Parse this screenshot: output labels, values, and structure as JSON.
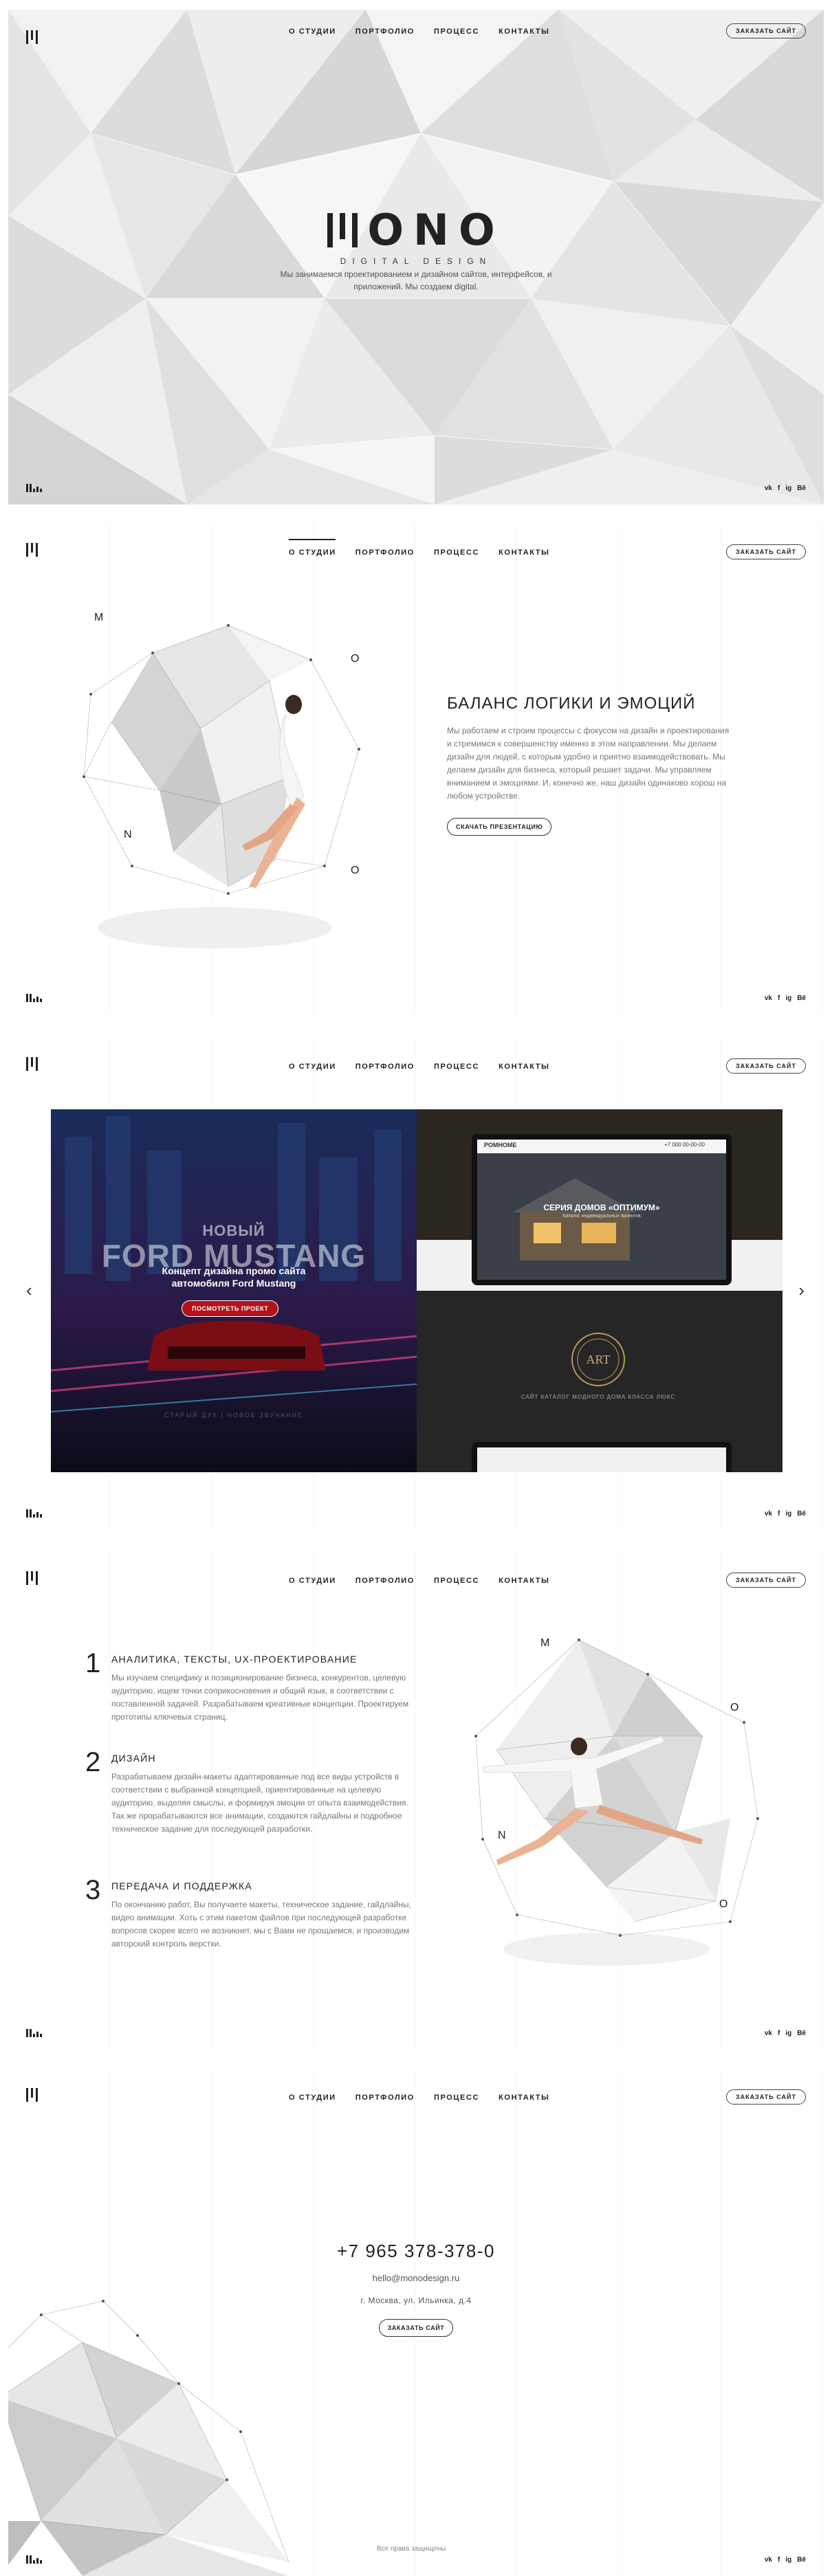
{
  "nav": [
    "О СТУДИИ",
    "ПОРТФОЛИО",
    "ПРОЦЕСС",
    "КОНТАКТЫ"
  ],
  "order_button": "ЗАКАЗАТЬ САЙТ",
  "socials": [
    "vk",
    "f",
    "ig",
    "Bē"
  ],
  "hero": {
    "logo_word": "ONO",
    "logo_sub": "DIGITAL DESIGN",
    "text": "Мы занимаемся проектированием и дизайном сайтов, интерфейсов, и приложений. Мы создаем digital."
  },
  "balance": {
    "title": "БАЛАНС ЛОГИКИ И ЭМОЦИЙ",
    "text": "Мы работаем и строим процессы с фокусом на дизайн и проектирования и стремимся к совершенству именно в этом направлении. Мы делаем дизайн для людей, с которым удобно и приятно взаимодействовать. Мы делаем дизайн для бизнеса, который решает задачи. Мы управляем вниманием и эмоциями. И, конечно же, наш дизайн одинаково хорош на любом устройстве.",
    "button": "СКАЧАТЬ ПРЕЗЕНТАЦИЮ",
    "letters": [
      "M",
      "O",
      "N",
      "O"
    ]
  },
  "portfolio": {
    "mustang_new": "НОВЫЙ",
    "mustang_title": "FORD MUSTANG",
    "mustang_caption": "Концепт дизайна промо сайта автомобиля Ford Mustang",
    "mustang_button": "ПОСМОТРЕТЬ ПРОЕКТ",
    "mustang_footer": "СТАРЫЙ ДУХ | НОВОЕ ЗВУЧАНИЕ",
    "house_brand": "РОМНОМЕ",
    "house_phone": "+7 000 00-00-00",
    "house_title": "СЕРИЯ ДОМОВ «ОПТИМУМ»",
    "house_caption": "Каталог индивидуальных проектов",
    "art_emblem": "ART",
    "art_caption": "САЙТ КАТАЛОГ МОДНОГО ДОМА КЛАССА ЛЮКС"
  },
  "process": {
    "letters": [
      "M",
      "O",
      "N",
      "O"
    ],
    "steps": [
      {
        "num": "1",
        "title": "АНАЛИТИКА, ТЕКСТЫ, UX-ПРОЕКТИРОВАНИЕ",
        "text": "Мы изучаем специфику и позиционирование бизнеса, конкурентов, целевую аудиторию, ищем точки соприкосновения и общий язык, в соответствии с поставленной задачей. Разрабатываем креативные концепции. Проектируем прототипы ключевых страниц."
      },
      {
        "num": "2",
        "title": "ДИЗАЙН",
        "text": "Разрабатываем дизайн-макеты адаптированные под все виды устройств в соответствии с выбранной концепцией, ориентированные на целевую аудиторию, выделяя смыслы, и формируя эмоции от опыта взаимодействия. Так же прорабатываются все анимации, создаются гайдлайны и подробное техническое задание для последующей разработки."
      },
      {
        "num": "3",
        "title": "ПЕРЕДАЧА И ПОДДЕРЖКА",
        "text": "По окончанию работ, Вы получаете макеты, техническое задание, гайдлайны, видео анимации. Хоть с этим пакетом файлов при последующей разработке вопросов скорее всего не возникнет, мы с Вами не прощаемся, и производим авторский контроль верстки."
      }
    ]
  },
  "contacts": {
    "phone": "+7 965 378-378-0",
    "email": "hello@monodesign.ru",
    "address": "г. Москва, ул. Ильинка, д.4",
    "button": "ЗАКАЗАТЬ САЙТ",
    "copyright": "Все права защищены"
  }
}
